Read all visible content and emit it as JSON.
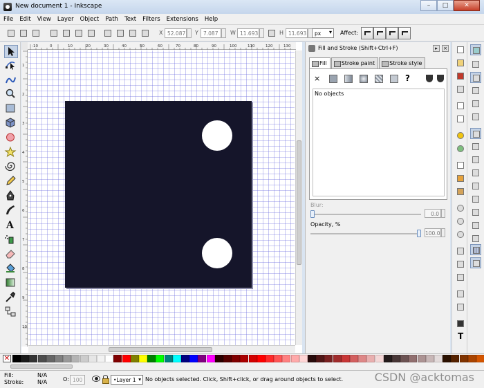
{
  "window": {
    "title": "New document 1 - Inkscape"
  },
  "menu": [
    "File",
    "Edit",
    "View",
    "Layer",
    "Object",
    "Path",
    "Text",
    "Filters",
    "Extensions",
    "Help"
  ],
  "controls": {
    "x_label": "X",
    "x_value": "52.087",
    "y_label": "Y",
    "y_value": "7.087",
    "w_label": "W",
    "w_value": "11.693",
    "h_label": "H",
    "h_value": "11.693",
    "unit": "px",
    "affect_label": "Affect:"
  },
  "ruler_labels": [
    "-10",
    "0",
    "10",
    "20",
    "30",
    "40",
    "50",
    "60",
    "70",
    "80",
    "90",
    "100",
    "110",
    "120",
    "130"
  ],
  "vruler_labels": [
    "1",
    "2",
    "3",
    "4",
    "5",
    "6",
    "7",
    "8",
    "9",
    "10"
  ],
  "panel": {
    "title": "Fill and Stroke (Shift+Ctrl+F)",
    "tabs": [
      "Fill",
      "Stroke paint",
      "Stroke style"
    ],
    "no_paint_symbol": "×",
    "unknown_symbol": "?",
    "no_objects": "No objects",
    "blur_label": "Blur:",
    "blur_value": "0.0",
    "opacity_label": "Opacity, %",
    "opacity_value": "100.0",
    "blur_level": 0,
    "opacity_level": 1.0
  },
  "statusbar": {
    "fill_label": "Fill:",
    "fill_value": "N/A",
    "stroke_label": "Stroke:",
    "stroke_value": "N/A",
    "opacity_label": "O:",
    "opacity_value": "100",
    "layer": "•Layer 1",
    "message": "No objects selected. Click, Shift+click, or drag around objects to select.",
    "watermark": "CSDN @acktomas"
  },
  "palette": [
    "#000000",
    "#1a1a1a",
    "#333333",
    "#4d4d4d",
    "#666666",
    "#808080",
    "#999999",
    "#b3b3b3",
    "#cccccc",
    "#e6e6e6",
    "#f2f2f2",
    "#ffffff",
    "#800000",
    "#ff0000",
    "#808000",
    "#ffff00",
    "#008000",
    "#00ff00",
    "#008080",
    "#00ffff",
    "#000080",
    "#0000ff",
    "#800080",
    "#ff00ff",
    "#2b0000",
    "#550000",
    "#800000",
    "#aa0000",
    "#d40000",
    "#ff0000",
    "#ff2a2a",
    "#ff5555",
    "#ff8080",
    "#ffaaaa",
    "#ffd5d5",
    "#280b0b",
    "#501616",
    "#782121",
    "#a02c2c",
    "#c83737",
    "#d35f5f",
    "#de8787",
    "#e9afaf",
    "#f4d7d7",
    "#241c1c",
    "#483737",
    "#6c5353",
    "#916f6f",
    "#ac9393",
    "#c8b7b7",
    "#e3dbdb",
    "#2b1100",
    "#552200",
    "#803300",
    "#aa4400",
    "#d45500"
  ]
}
